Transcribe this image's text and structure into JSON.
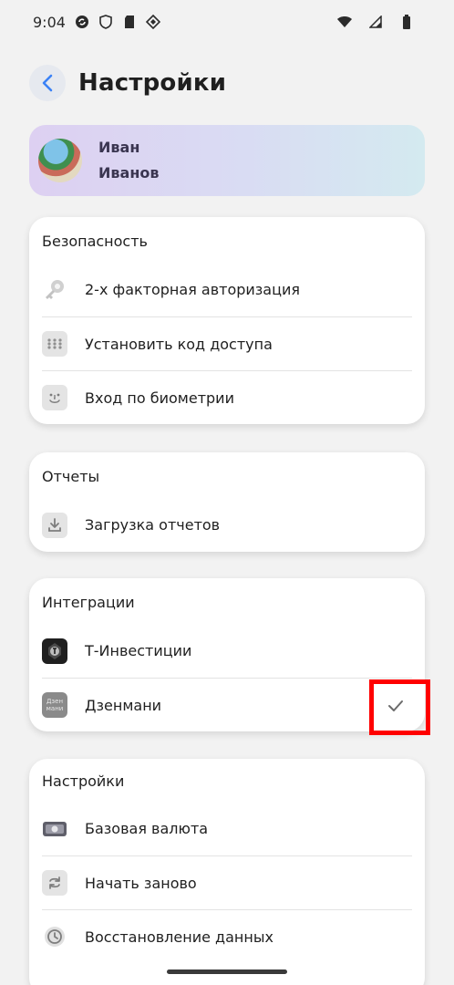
{
  "status_bar": {
    "time": "9:04"
  },
  "header": {
    "title": "Настройки"
  },
  "profile": {
    "first_name": "Иван",
    "last_name": "Иванов"
  },
  "sections": {
    "security": {
      "title": "Безопасность",
      "items": [
        {
          "label": "2-х факторная авторизация",
          "icon": "key-icon"
        },
        {
          "label": "Установить код доступа",
          "icon": "keypad-icon"
        },
        {
          "label": "Вход по биометрии",
          "icon": "face-id-icon"
        }
      ]
    },
    "reports": {
      "title": "Отчеты",
      "items": [
        {
          "label": "Загрузка отчетов",
          "icon": "download-icon"
        }
      ]
    },
    "integrations": {
      "title": "Интеграции",
      "items": [
        {
          "label": "Т-Инвестиции",
          "icon": "t-investments-logo"
        },
        {
          "label": "Дзенмани",
          "icon": "zenmoney-logo",
          "logo_text": "Дзен мани",
          "checked": true
        }
      ]
    },
    "settings": {
      "title": "Настройки",
      "items": [
        {
          "label": "Базовая валюта",
          "icon": "banknote-icon"
        },
        {
          "label": "Начать заново",
          "icon": "restart-icon"
        },
        {
          "label": "Восстановление данных",
          "icon": "history-icon"
        }
      ]
    }
  },
  "colors": {
    "accent": "#3b82f6",
    "check": "#6b6b6b",
    "icon_gray": "#9a9a9a"
  }
}
